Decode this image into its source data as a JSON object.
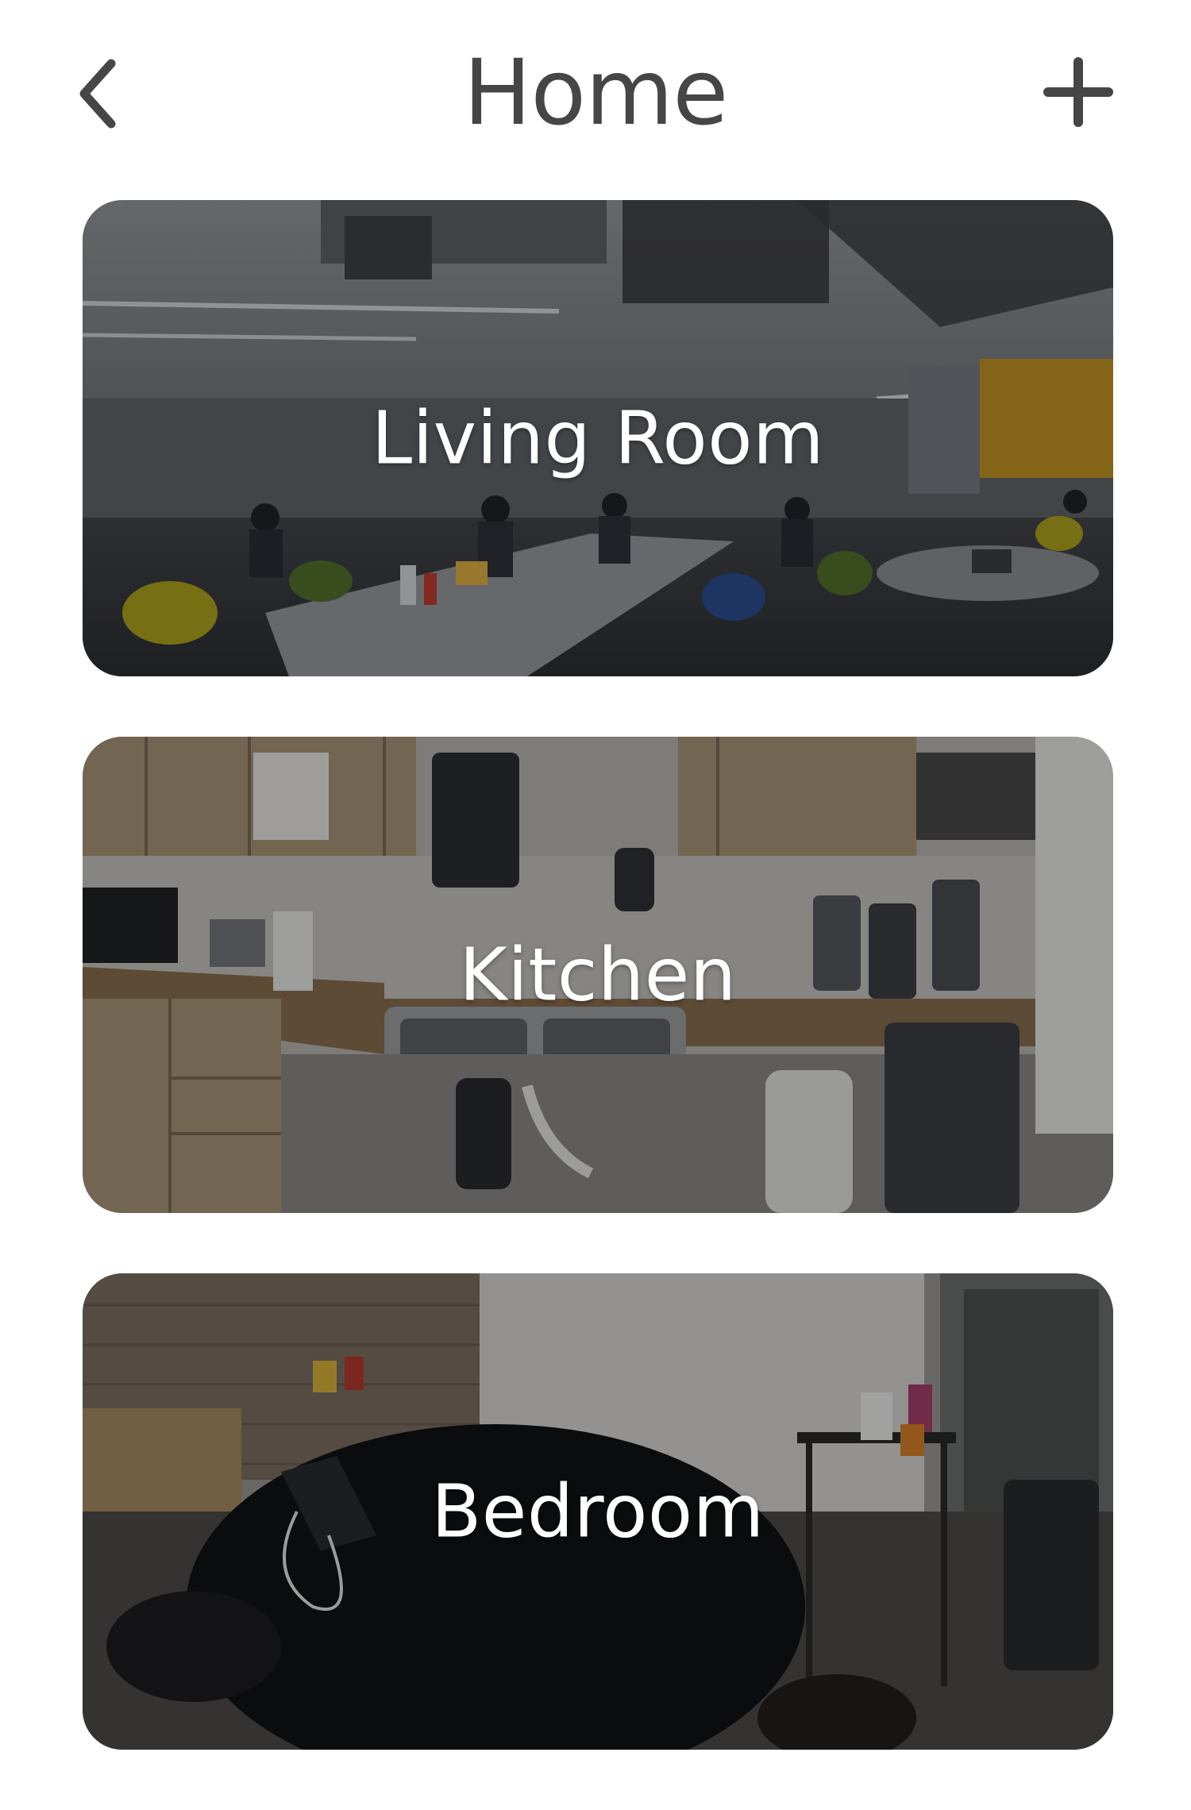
{
  "header": {
    "title": "Home",
    "back_icon": "chevron-left-icon",
    "add_icon": "plus-icon",
    "color": "#464646"
  },
  "rooms": [
    {
      "label": "Living Room"
    },
    {
      "label": "Kitchen"
    },
    {
      "label": "Bedroom"
    }
  ]
}
